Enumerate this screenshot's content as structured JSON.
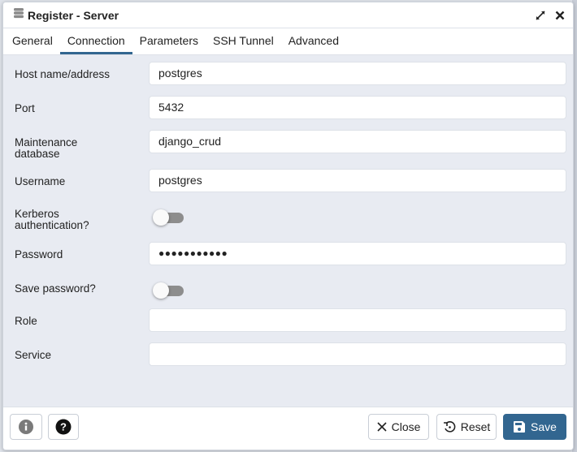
{
  "dialog": {
    "title": "Register - Server",
    "icons": {
      "title": "server-icon",
      "maximize": "expand-icon",
      "close": "close-icon"
    }
  },
  "tabs": [
    {
      "label": "General",
      "active": false
    },
    {
      "label": "Connection",
      "active": true
    },
    {
      "label": "Parameters",
      "active": false
    },
    {
      "label": "SSH Tunnel",
      "active": false
    },
    {
      "label": "Advanced",
      "active": false
    }
  ],
  "form": {
    "host": {
      "label": "Host name/address",
      "value": "postgres"
    },
    "port": {
      "label": "Port",
      "value": "5432"
    },
    "maintenance_db": {
      "label_line1": "Maintenance",
      "label_line2": "database",
      "value": "django_crud"
    },
    "username": {
      "label": "Username",
      "value": "postgres"
    },
    "kerberos": {
      "label_line1": "Kerberos",
      "label_line2": "authentication?",
      "enabled": false
    },
    "password": {
      "label": "Password",
      "value": "●●●●●●●●●●●"
    },
    "save_password": {
      "label": "Save password?",
      "enabled": false
    },
    "role": {
      "label": "Role",
      "value": ""
    },
    "service": {
      "label": "Service",
      "value": ""
    }
  },
  "footer": {
    "info_icon": "info-icon",
    "help_icon": "help-icon",
    "close_label": "Close",
    "reset_label": "Reset",
    "save_label": "Save",
    "accent_color": "#326690"
  }
}
